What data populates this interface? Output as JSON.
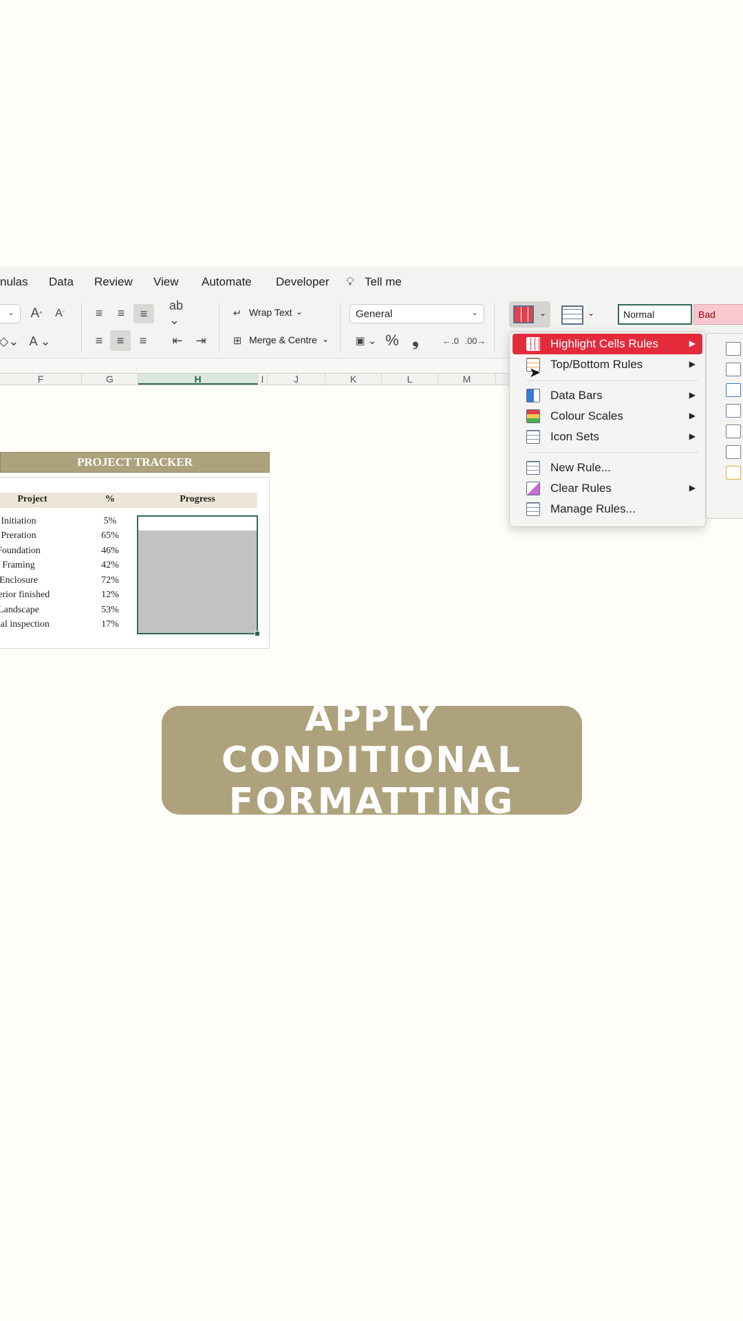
{
  "menubar": {
    "tabs": [
      "nulas",
      "Data",
      "Review",
      "View",
      "Automate",
      "Developer"
    ],
    "tell_me": "Tell me"
  },
  "toolbar": {
    "wrap_text": "Wrap Text",
    "merge_centre": "Merge & Centre",
    "number_format": "General",
    "percent": "%",
    "comma": "❟",
    "styles": {
      "normal": "Normal",
      "bad": "Bad"
    }
  },
  "columns": [
    "F",
    "G",
    "H",
    "I",
    "J",
    "K",
    "L",
    "M"
  ],
  "tracker": {
    "title": "PROJECT TRACKER",
    "headers": {
      "project": "Project",
      "pct": "%",
      "progress": "Progress"
    },
    "rows": [
      {
        "name": "Initiation",
        "pct": "5%"
      },
      {
        "name": "Preration",
        "pct": "65%"
      },
      {
        "name": "Foundation",
        "pct": "46%"
      },
      {
        "name": "Framing",
        "pct": "42%"
      },
      {
        "name": "Enclosure",
        "pct": "72%"
      },
      {
        "name": "Interior finished",
        "pct": "12%"
      },
      {
        "name": "Landscape",
        "pct": "53%"
      },
      {
        "name": "Final inspection",
        "pct": "17%"
      }
    ]
  },
  "cf_menu": {
    "items": [
      {
        "label": "Highlight Cells Rules",
        "submenu": true,
        "active": true
      },
      {
        "label": "Top/Bottom Rules",
        "submenu": true
      },
      {
        "label": "Data Bars",
        "submenu": true
      },
      {
        "label": "Colour Scales",
        "submenu": true
      },
      {
        "label": "Icon Sets",
        "submenu": true
      },
      {
        "label": "New Rule...",
        "submenu": false
      },
      {
        "label": "Clear Rules",
        "submenu": true
      },
      {
        "label": "Manage Rules...",
        "submenu": false
      }
    ]
  },
  "caption": {
    "line1": "APPLY CONDITIONAL",
    "line2": "FORMATTING"
  },
  "colors": {
    "accent": "#ada27c",
    "menu_active": "#e32b3c",
    "selection": "#2d6a4f"
  }
}
